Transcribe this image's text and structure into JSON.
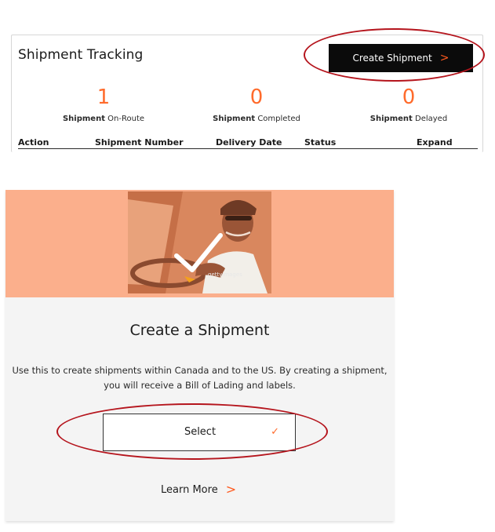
{
  "tracking": {
    "title": "Shipment Tracking",
    "create_button": {
      "label": "Create Shipment",
      "chevron": ">"
    },
    "stats": [
      {
        "value": "1",
        "prefix": "Shipment",
        "suffix": "On-Route"
      },
      {
        "value": "0",
        "prefix": "Shipment",
        "suffix": "Completed"
      },
      {
        "value": "0",
        "prefix": "Shipment",
        "suffix": "Delayed"
      }
    ],
    "columns": [
      "Action",
      "Shipment Number",
      "Delivery Date",
      "Status",
      "Expand"
    ]
  },
  "card": {
    "watermark": "gettyimages",
    "title": "Create a Shipment",
    "description": "Use this to create shipments within Canada and to the US. By creating a shipment, you will receive a Bill of Lading and labels.",
    "select_button": {
      "label": "Select",
      "check": "✓"
    },
    "learn_more": {
      "label": "Learn More",
      "chevron": ">"
    }
  },
  "colors": {
    "accent": "#ff6b2c",
    "hero_overlay": "#fbaf8c",
    "annotation": "#b5151d",
    "button_dark": "#0b0b0b"
  }
}
